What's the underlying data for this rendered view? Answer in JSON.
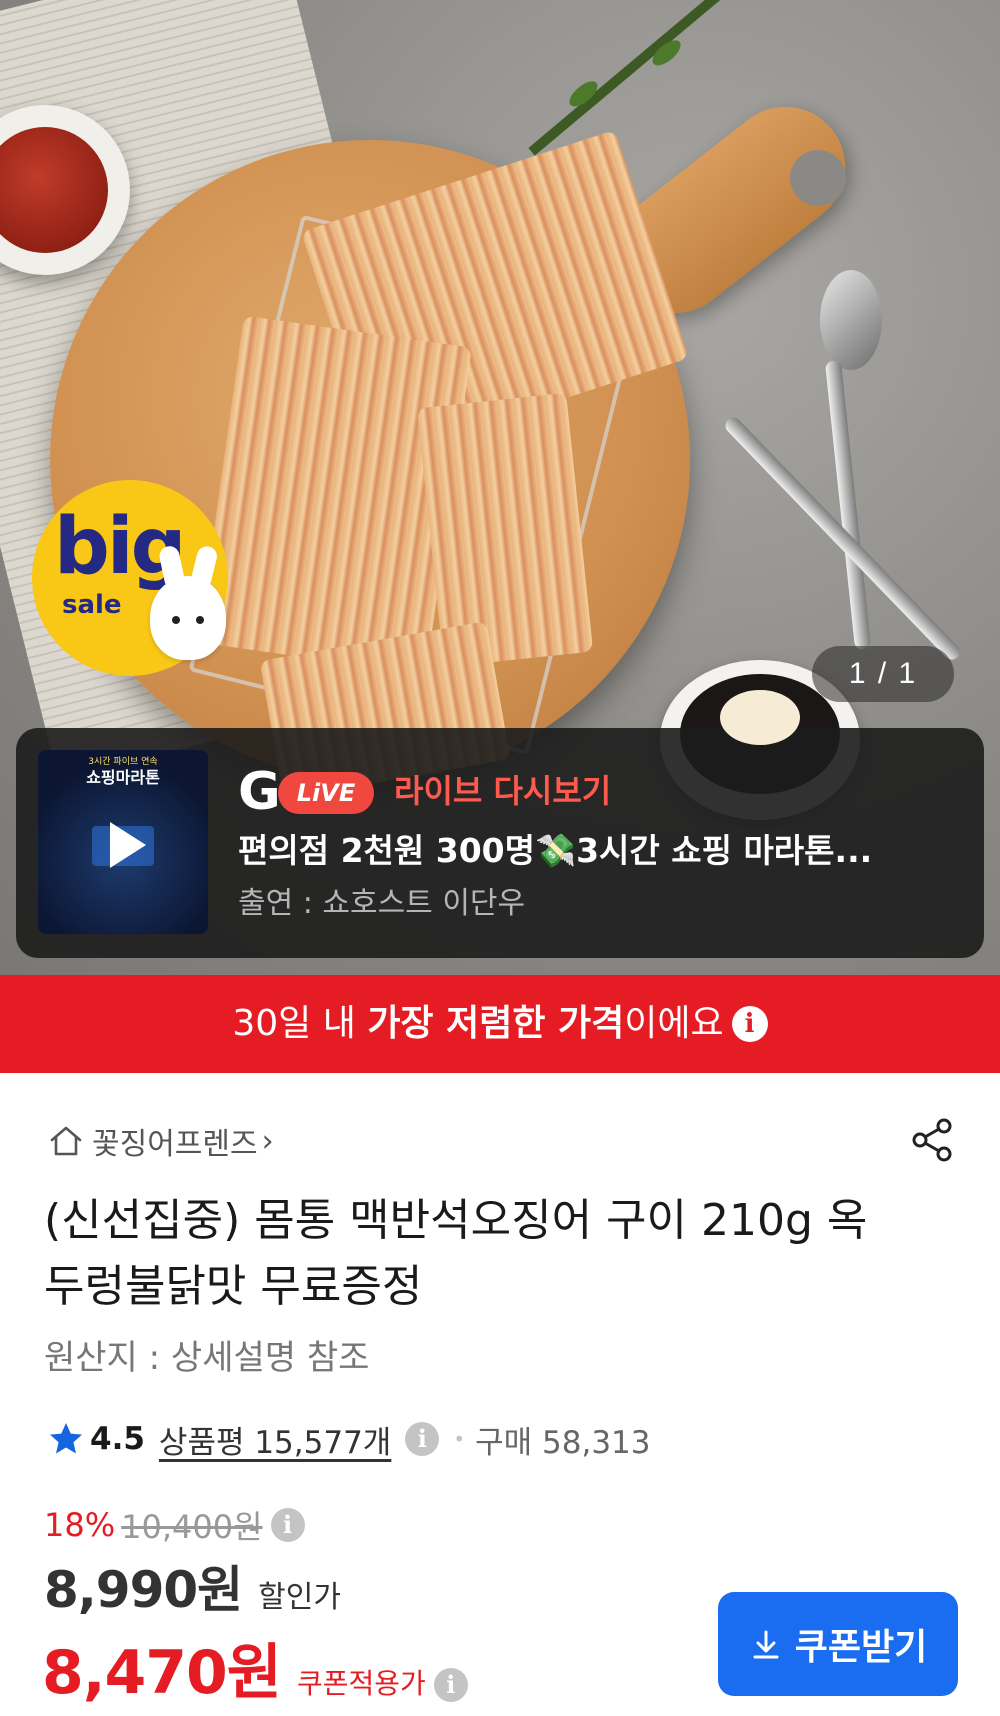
{
  "hero": {
    "page_counter": "1 / 1",
    "badge": {
      "big": "big",
      "sale": "sale"
    }
  },
  "live": {
    "thumb_subtitle": "3시간 파이브 연속",
    "thumb_title": "쇼핑마라톤",
    "logo_g": "G",
    "logo_pill": "LiVE",
    "replay_label": "라이브 다시보기",
    "title": "편의점 2천원 300명💸3시간 쇼핑 마라톤...",
    "host": "출연 : 쇼호스트 이단우"
  },
  "banner": {
    "prefix": "30일 내 ",
    "bold": "가장 저렴한 가격",
    "suffix": "이에요",
    "info": "i",
    "color": "#e51c23"
  },
  "store": {
    "name": "꽃징어프렌즈",
    "chevron": "›"
  },
  "product": {
    "title": "(신선집중) 몸통 맥반석오징어 구이 210g 옥두렁불닭맛 무료증정",
    "origin": "원산지 : 상세설명 참조"
  },
  "rating": {
    "score": "4.5",
    "reviews": "상품평 15,577개",
    "info": "i",
    "dot": "•",
    "purchases": "구매 58,313"
  },
  "pricing": {
    "discount_pct": "18%",
    "original_price": "10,400원",
    "info": "i",
    "sale_price": "8,990원",
    "sale_label": "할인가",
    "coupon_price": "8,470원",
    "coupon_label": "쿠폰적용가",
    "coupon_button": "쿠폰받기",
    "accent_blue": "#1a6cf0"
  },
  "icons": [
    "home-icon",
    "share-icon",
    "star-icon",
    "info-icon",
    "download-icon",
    "play-icon"
  ]
}
